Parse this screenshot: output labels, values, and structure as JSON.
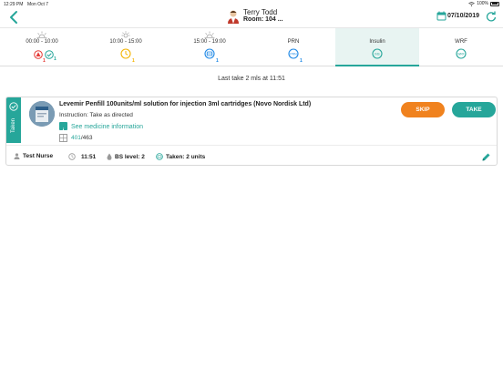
{
  "status_bar": {
    "time": "12:29 PM",
    "date": "Mon Oct 7",
    "battery": "100%"
  },
  "header": {
    "patient_name": "Terry Todd",
    "room": "Room: 104 ...",
    "date": "07/10/2019"
  },
  "tabs": [
    {
      "label": "00:00 - 10:00",
      "badge_red": "1",
      "badge_green": "1"
    },
    {
      "label": "10:00 - 15:00",
      "badge": "1"
    },
    {
      "label": "15:00 - 19:00",
      "badge": "1"
    },
    {
      "label": "PRN",
      "badge": "1"
    },
    {
      "label": "Insulin"
    },
    {
      "label": "WRF"
    }
  ],
  "last_take": "Last take 2 mls at 11:51",
  "card": {
    "status_label": "Taken",
    "drug_name": "Levemir Penfill 100units/ml solution for injection 3ml cartridges (Novo Nordisk Ltd)",
    "instruction": "Instruction: Take as directed",
    "info_link": "See medicine information",
    "stock_current": "401",
    "stock_total": "/463",
    "skip_label": "SKIP",
    "take_label": "TAKE",
    "nurse": "Test Nurse",
    "time": "11:51",
    "bs_level": "BS level: 2",
    "taken": "Taken: 2 units"
  },
  "colors": {
    "accent": "#26a69a",
    "skip": "#f0821e",
    "warning": "#f4b400",
    "alert": "#e53935",
    "blue": "#1e88e5"
  }
}
